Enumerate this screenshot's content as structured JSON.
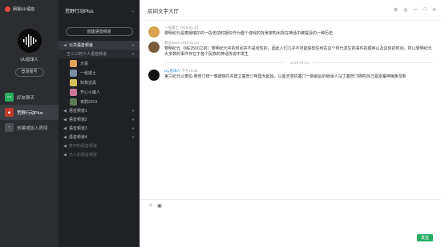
{
  "app": {
    "brand": "网易UU语音"
  },
  "user": {
    "name": "UU星球人",
    "logout_label": "登录账号"
  },
  "nav": [
    {
      "label": "好友聊天"
    },
    {
      "label": "荒野行动Plus"
    },
    {
      "label": "创建或加入房间"
    }
  ],
  "channel_panel": {
    "title": "荒野行动Plus",
    "create_label": "创建语音频道",
    "public_channel": "公共语音频道",
    "group": "王三三的个人语音频道",
    "members": [
      "大富",
      "一纸媚士",
      "知我逆黑",
      "开心小魔人",
      "夜鸦2019"
    ],
    "channels": [
      "语音频道1",
      "语音频道2",
      "语音频道3",
      "语音频道4"
    ],
    "disabled": [
      "禁开的语音频道",
      "无人的语音频道"
    ]
  },
  "chat": {
    "title": "房间文字大厅",
    "messages": [
      {
        "sender": "一纸媚士",
        "time": "2019-01-23",
        "text": "黎明纪元是泰姆瑞尔的一段史前时期仅作为整个游戏的背景架构出现在神话中被提及的一种历史"
      },
      {
        "sender": "教员2019",
        "time": "2019-01-23",
        "text": "黎明纪元（ME2500之前）黎明纪元中的时间并不是线性的，因此人们几乎不可能获知任何在这个时代发生的事件的顺序以及具体的时间。所以黎明纪元大多数的事件存在于各个民族的神话传说中发生"
      }
    ],
    "date_divider": "2019-01-24",
    "last_message": {
      "sender": "UU星球人",
      "time": "下午15:30",
      "text": "第三纪元以泰伯·赛普汀统一泰姆瑞尔并建立塞普汀帝国为起始，以屋天苍机塞汀一脉最后的继承人马丁塞普汀牺牲自己驱逐魔神梅鲁涅斯"
    },
    "send_label": "发送"
  }
}
